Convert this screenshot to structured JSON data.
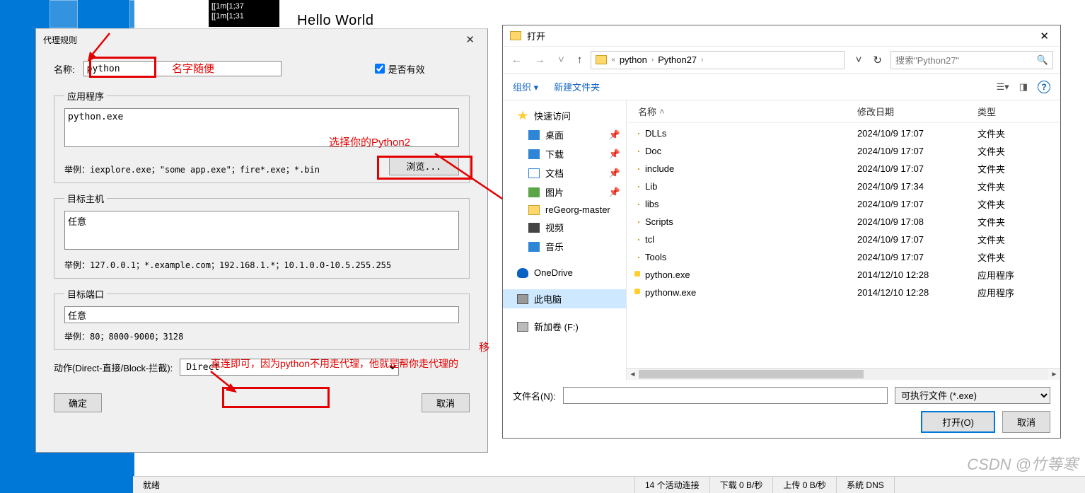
{
  "terminal": {
    "line1": "[[1m[1;37",
    "line2": "[[1m[1;31"
  },
  "hello": "Hello World",
  "proxy_dialog": {
    "title": "代理规则",
    "name_label": "名称:",
    "name_value": "python",
    "valid_label": "是否有效",
    "app": {
      "legend": "应用程序",
      "value": "python.exe",
      "example_label": "举例：iexplore.exe；\"some app.exe\"；fire*.exe；*.bin",
      "browse": "浏览..."
    },
    "host": {
      "legend": "目标主机",
      "value": "任意",
      "example_label": "举例：127.0.0.1；*.example.com；192.168.1.*；10.1.0.0-10.5.255.255"
    },
    "port": {
      "legend": "目标端口",
      "value": "任意",
      "example_label": "举例：80；8000-9000；3128"
    },
    "action_label": "动作(Direct-直接/Block-拦截):",
    "action_value": "Direct",
    "ok": "确定",
    "cancel": "取消"
  },
  "annotations": {
    "name_hint": "名字随便",
    "browse_hint": "选择你的Python2",
    "action_hint": "直连即可，因为python不用走代理，他就是帮你走代理的",
    "side_label": "移"
  },
  "open_dialog": {
    "title": "打开",
    "breadcrumb": {
      "p1": "python",
      "p2": "Python27"
    },
    "search_placeholder": "搜索\"Python27\"",
    "organize": "组织 ▾",
    "new_folder": "新建文件夹",
    "tree": {
      "quick": "快速访问",
      "desktop": "桌面",
      "downloads": "下载",
      "documents": "文档",
      "pictures": "图片",
      "regeorg": "reGeorg-master",
      "videos": "视频",
      "music": "音乐",
      "onedrive": "OneDrive",
      "thispc": "此电脑",
      "volume": "新加卷 (F:)"
    },
    "cols": {
      "name": "名称",
      "date": "修改日期",
      "type": "类型"
    },
    "files": [
      {
        "name": "DLLs",
        "date": "2024/10/9 17:07",
        "type": "文件夹",
        "kind": "folder"
      },
      {
        "name": "Doc",
        "date": "2024/10/9 17:07",
        "type": "文件夹",
        "kind": "folder"
      },
      {
        "name": "include",
        "date": "2024/10/9 17:07",
        "type": "文件夹",
        "kind": "folder"
      },
      {
        "name": "Lib",
        "date": "2024/10/9 17:34",
        "type": "文件夹",
        "kind": "folder"
      },
      {
        "name": "libs",
        "date": "2024/10/9 17:07",
        "type": "文件夹",
        "kind": "folder"
      },
      {
        "name": "Scripts",
        "date": "2024/10/9 17:08",
        "type": "文件夹",
        "kind": "folder"
      },
      {
        "name": "tcl",
        "date": "2024/10/9 17:07",
        "type": "文件夹",
        "kind": "folder"
      },
      {
        "name": "Tools",
        "date": "2024/10/9 17:07",
        "type": "文件夹",
        "kind": "folder"
      },
      {
        "name": "python.exe",
        "date": "2014/12/10 12:28",
        "type": "应用程序",
        "kind": "exe"
      },
      {
        "name": "pythonw.exe",
        "date": "2014/12/10 12:28",
        "type": "应用程序",
        "kind": "exe"
      }
    ],
    "filename_label": "文件名(N):",
    "filename_value": "",
    "filter": "可执行文件 (*.exe)",
    "open_btn": "打开(O)",
    "cancel": "取消"
  },
  "status": {
    "ready": "就绪",
    "conn": "14 个活动连接",
    "down": "下载 0 B/秒",
    "up": "上传 0 B/秒",
    "dns": "系统 DNS"
  },
  "watermark": "CSDN @竹等寒"
}
